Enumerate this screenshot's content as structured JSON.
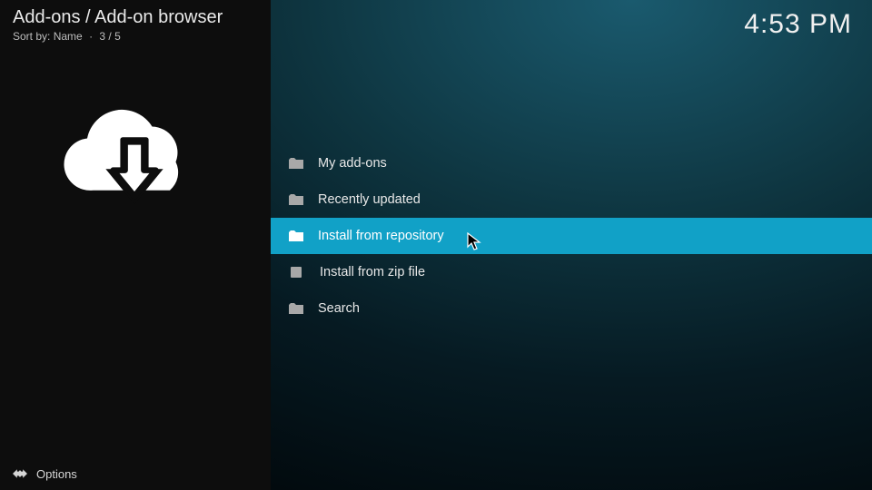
{
  "header": {
    "breadcrumb": "Add-ons / Add-on browser",
    "sort_label": "Sort by:",
    "sort_value": "Name",
    "position": "3 / 5",
    "clock": "4:53 PM"
  },
  "menu": {
    "items": [
      {
        "label": "My add-ons",
        "icon": "folder",
        "selected": false
      },
      {
        "label": "Recently updated",
        "icon": "folder",
        "selected": false
      },
      {
        "label": "Install from repository",
        "icon": "folder",
        "selected": true
      },
      {
        "label": "Install from zip file",
        "icon": "zip",
        "selected": false
      },
      {
        "label": "Search",
        "icon": "folder",
        "selected": false
      }
    ]
  },
  "footer": {
    "options_label": "Options"
  },
  "colors": {
    "highlight": "#11a1c7"
  }
}
